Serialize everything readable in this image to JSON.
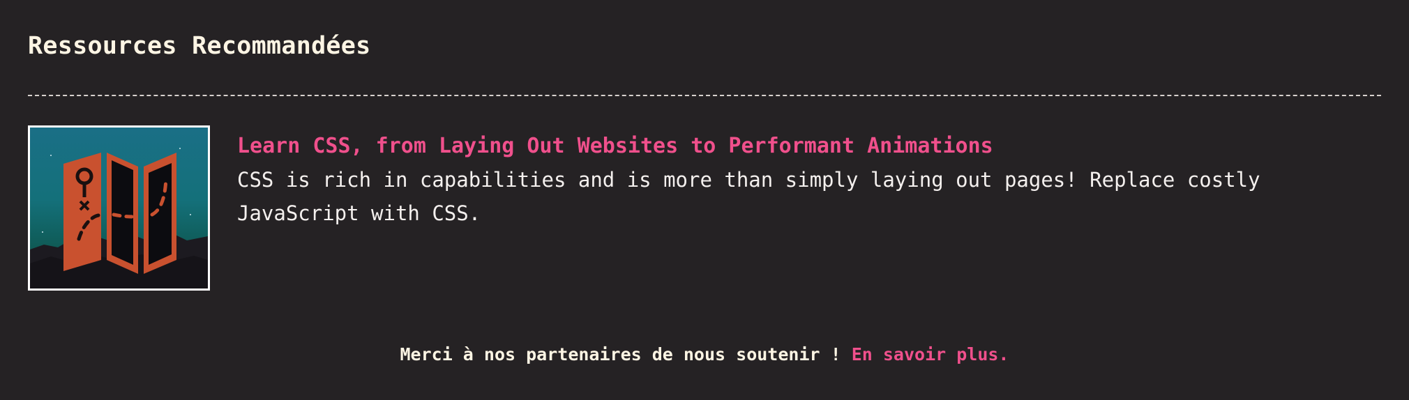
{
  "section": {
    "title": "Ressources Recommandées"
  },
  "resources": [
    {
      "title": "Learn CSS, from Laying Out Websites to Performant Animations",
      "description": "CSS is rich in capabilities and is more than simply laying out pages! Replace costly JavaScript with CSS.",
      "thumbnail_icon": "treasure-map-icon"
    }
  ],
  "footer": {
    "thanks_text": "Merci à nos partenaires de nous soutenir ! ",
    "learn_more_link": "En savoir plus."
  },
  "colors": {
    "background": "#252224",
    "accent": "#f0508c",
    "heading": "#fdf5e4",
    "text": "#f4f0ee",
    "map_orange": "#c9512f"
  }
}
